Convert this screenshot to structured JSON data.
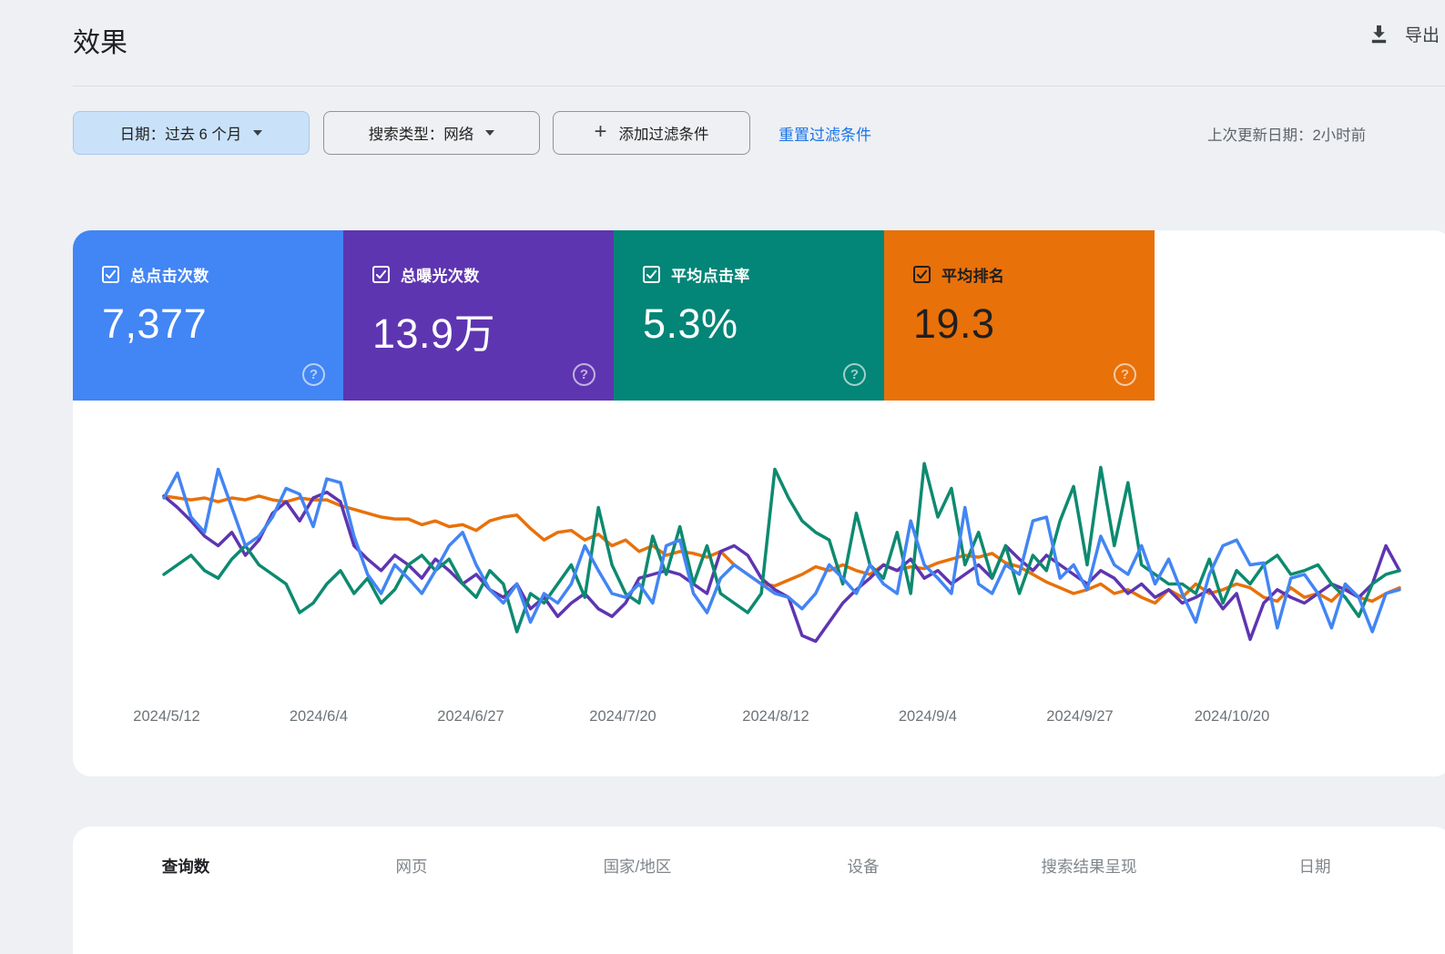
{
  "header": {
    "title": "效果",
    "export_label": "导出"
  },
  "filters": {
    "date_chip": "日期：过去 6 个月",
    "search_type_chip": "搜索类型：网络",
    "add_filter_chip": "添加过滤条件",
    "reset_link": "重置过滤条件",
    "last_updated": "上次更新日期：2小时前"
  },
  "metric_cards": [
    {
      "id": "clicks",
      "label": "总点击次数",
      "value": "7,377",
      "color": "#4285f4",
      "text_color": "#ffffff",
      "checked": true
    },
    {
      "id": "impressions",
      "label": "总曝光次数",
      "value": "13.9万",
      "color": "#5e35b1",
      "text_color": "#ffffff",
      "checked": true
    },
    {
      "id": "ctr",
      "label": "平均点击率",
      "value": "5.3%",
      "color": "#038577",
      "text_color": "#ffffff",
      "checked": true
    },
    {
      "id": "position",
      "label": "平均排名",
      "value": "19.3",
      "color": "#e8710a",
      "text_color": "#1f1f1f",
      "checked": true
    }
  ],
  "chart_data": {
    "type": "line",
    "title": "",
    "x_tick_labels": [
      "2024/5/12",
      "2024/6/4",
      "2024/6/27",
      "2024/7/20",
      "2024/8/12",
      "2024/9/4",
      "2024/9/27",
      "2024/10/20"
    ],
    "x_range_days": 184,
    "points_per_series": 92,
    "y_axis": "hidden",
    "grid": "off",
    "legend_position": "none (metric cards act as legend)",
    "value_unit": "relative height percent of plot area (0 = bottom, 100 = top); absolute y scales are not displayed in the UI",
    "series": [
      {
        "name": "平均排名",
        "metric_total": "19.3",
        "color": "#e8710a",
        "values": [
          81,
          80,
          79,
          80,
          78,
          80,
          79,
          81,
          79,
          78,
          80,
          79,
          79,
          76,
          74,
          72,
          70,
          69,
          69,
          66,
          68,
          65,
          66,
          63,
          68,
          70,
          71,
          64,
          58,
          62,
          63,
          58,
          61,
          55,
          58,
          52,
          55,
          50,
          52,
          51,
          49,
          52,
          45,
          40,
          35,
          34,
          37,
          40,
          44,
          42,
          45,
          42,
          40,
          45,
          42,
          44,
          43,
          46,
          48,
          50,
          49,
          51,
          46,
          44,
          40,
          36,
          33,
          30,
          32,
          35,
          30,
          32,
          28,
          25,
          32,
          28,
          35,
          30,
          32,
          35,
          33,
          28,
          26,
          33,
          28,
          30,
          26,
          33,
          28,
          26,
          30,
          33
        ]
      },
      {
        "name": "总曝光次数",
        "metric_total": "13.9万",
        "color": "#5e35b1",
        "values": [
          81,
          75,
          68,
          60,
          55,
          62,
          50,
          58,
          72,
          78,
          68,
          80,
          83,
          78,
          55,
          48,
          42,
          50,
          45,
          38,
          48,
          42,
          35,
          40,
          32,
          28,
          35,
          22,
          28,
          18,
          25,
          30,
          22,
          18,
          25,
          38,
          40,
          42,
          40,
          35,
          30,
          52,
          55,
          50,
          38,
          32,
          28,
          8,
          5,
          15,
          25,
          32,
          38,
          45,
          42,
          48,
          38,
          42,
          35,
          40,
          45,
          38,
          55,
          48,
          42,
          50,
          45,
          40,
          35,
          42,
          38,
          30,
          35,
          28,
          32,
          25,
          28,
          32,
          22,
          30,
          6,
          25,
          32,
          28,
          25,
          30,
          35,
          32,
          28,
          35,
          55,
          42
        ]
      },
      {
        "name": "平均点击率",
        "metric_total": "5.3%",
        "color": "#0d8a6f",
        "values": [
          40,
          45,
          50,
          42,
          38,
          48,
          55,
          45,
          40,
          35,
          20,
          25,
          35,
          42,
          30,
          38,
          25,
          32,
          45,
          50,
          42,
          48,
          35,
          28,
          42,
          35,
          10,
          30,
          25,
          35,
          45,
          28,
          75,
          45,
          30,
          25,
          60,
          40,
          65,
          35,
          55,
          30,
          25,
          20,
          30,
          95,
          80,
          68,
          62,
          58,
          35,
          72,
          45,
          38,
          62,
          30,
          98,
          70,
          85,
          45,
          62,
          38,
          55,
          30,
          50,
          42,
          68,
          86,
          45,
          96,
          55,
          88,
          45,
          40,
          35,
          35,
          30,
          48,
          25,
          42,
          35,
          45,
          50,
          40,
          42,
          45,
          35,
          28,
          18,
          35,
          40,
          42
        ]
      },
      {
        "name": "总点击次数",
        "metric_total": "7,377",
        "color": "#4285f4",
        "values": [
          80,
          93,
          70,
          62,
          95,
          75,
          55,
          60,
          70,
          85,
          82,
          65,
          90,
          88,
          60,
          40,
          30,
          45,
          38,
          30,
          42,
          55,
          62,
          45,
          32,
          25,
          35,
          15,
          30,
          25,
          35,
          55,
          42,
          30,
          28,
          35,
          25,
          55,
          58,
          30,
          20,
          38,
          45,
          40,
          35,
          30,
          28,
          22,
          30,
          45,
          38,
          30,
          45,
          35,
          30,
          68,
          45,
          38,
          30,
          75,
          35,
          30,
          45,
          40,
          68,
          70,
          38,
          45,
          32,
          60,
          45,
          40,
          55,
          35,
          48,
          30,
          15,
          40,
          55,
          58,
          45,
          46,
          12,
          38,
          40,
          30,
          12,
          35,
          28,
          10,
          30,
          32
        ]
      }
    ]
  },
  "tabs": [
    {
      "label": "查询数",
      "active": true
    },
    {
      "label": "网页",
      "active": false
    },
    {
      "label": "国家/地区",
      "active": false
    },
    {
      "label": "设备",
      "active": false
    },
    {
      "label": "搜索结果呈现",
      "active": false
    },
    {
      "label": "日期",
      "active": false
    }
  ]
}
